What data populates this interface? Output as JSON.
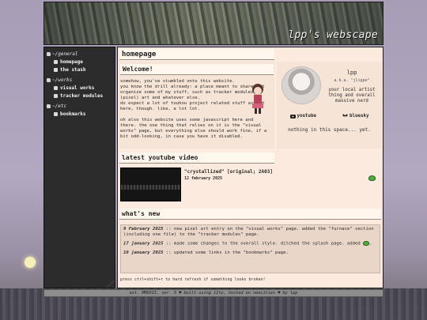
{
  "site": {
    "title": "lpp's webscape"
  },
  "nav": {
    "groups": [
      {
        "label": "~/general",
        "items": [
          {
            "label": "homepage"
          },
          {
            "label": "the stash"
          }
        ]
      },
      {
        "label": "~/works",
        "items": [
          {
            "label": "visual works"
          },
          {
            "label": "tracker modules"
          }
        ]
      },
      {
        "label": "~/etc",
        "items": [
          {
            "label": "bookmarks"
          }
        ]
      }
    ]
  },
  "main": {
    "page_title": "homepage",
    "welcome": {
      "title": "Welcome!",
      "text": "somehow, you've stumbled onto this website.\nyou know the drill already: a place meant to share and organize some of my stuff, such as tracker modules, (pixel) art and whatever else.\ndo expect a lot of touhou project related stuff around here, though. like, a lot lot.\n\noh also this website uses some javascript here and there. the one thing that relies on it is the \"visual works\" page, but everything else should work fine, if a bit odd-looking, in case you have it disabled."
    },
    "profile": {
      "name": "lpp",
      "aka": "a.k.a. \"jlippe\"",
      "desc": "your local artist thing and overall massive nerd",
      "links": [
        {
          "label": "youtube",
          "icon": "youtube-icon"
        },
        {
          "label": "bluesky",
          "icon": "butterfly-icon"
        }
      ],
      "nothing": "nothing in this space... yet."
    },
    "youtube": {
      "heading": "latest youtube video",
      "title": "\"crystallized\" [original; 2A03]",
      "date": "12 february 2025"
    },
    "news": {
      "heading": "what's new",
      "items": [
        {
          "date": "9 February 2025",
          "text": " :: new pixel art entry on the \"visual works\" page. added the \"furnace\" section (including one file) to the \"tracker modules\" page."
        },
        {
          "date": "17 january 2025",
          "text": " :: made some changes to the overall style. ditched the splash page. added"
        },
        {
          "date": "10 january 2025",
          "text": " :: updated some links in the \"bookmarks\" page."
        }
      ],
      "hint": "press ctrl+shift+r to hard refresh if something looks broken!"
    }
  },
  "footer": {
    "text": "est. MMXXII, ver. 5 ♥ built using 11ty, hosted on neocities ♥ by lpp"
  },
  "colors": {
    "accent": "#fbeadd",
    "sidebar": "#2c2c2c"
  }
}
